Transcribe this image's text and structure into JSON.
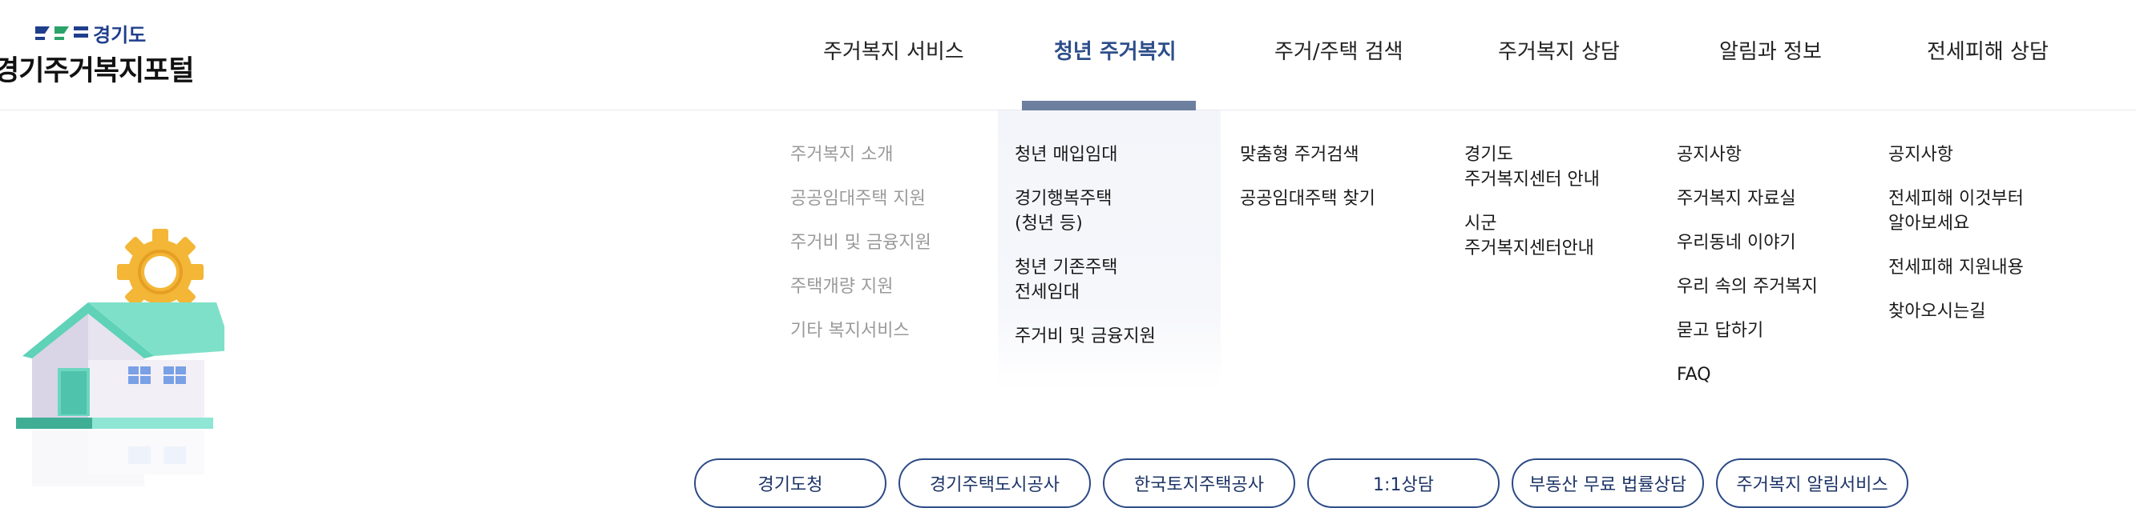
{
  "logo": {
    "mark_text": "경기도",
    "title": "경기주거복지포털"
  },
  "gnb": [
    {
      "label": "주거복지 서비스",
      "active": false
    },
    {
      "label": "청년 주거복지",
      "active": true
    },
    {
      "label": "주거/주택 검색",
      "active": false
    },
    {
      "label": "주거복지 상담",
      "active": false
    },
    {
      "label": "알림과 정보",
      "active": false
    },
    {
      "label": "전세피해 상담",
      "active": false
    }
  ],
  "menu": {
    "col1": [
      "주거복지 소개",
      "공공임대주택 지원",
      "주거비 및 금융지원",
      "주택개량 지원",
      "기타 복지서비스"
    ],
    "col2": [
      "청년 매입임대",
      "경기행복주택\n(청년 등)",
      "청년 기존주택\n전세임대",
      "주거비 및 금융지원"
    ],
    "col3": [
      "맞춤형 주거검색",
      "공공임대주택 찾기"
    ],
    "col4": [
      "경기도\n주거복지센터 안내",
      "시군\n주거복지센터안내"
    ],
    "col5": [
      "공지사항",
      "주거복지 자료실",
      "우리동네 이야기",
      "우리 속의 주거복지",
      "묻고 답하기",
      "FAQ"
    ],
    "col6": [
      "공지사항",
      "전세피해 이것부터\n알아보세요",
      "전세피해 지원내용",
      "찾아오시는길"
    ]
  },
  "quick_links": [
    "경기도청",
    "경기주택도시공사",
    "한국토지주택공사",
    "1:1상담",
    "부동산 무료 법률상담",
    "주거복지 알림서비스"
  ],
  "colors": {
    "brand_navy": "#1f3f8c",
    "brand_green": "#2aa36b",
    "active_blue": "#2d4e8a",
    "bar": "#6c7f9f"
  }
}
